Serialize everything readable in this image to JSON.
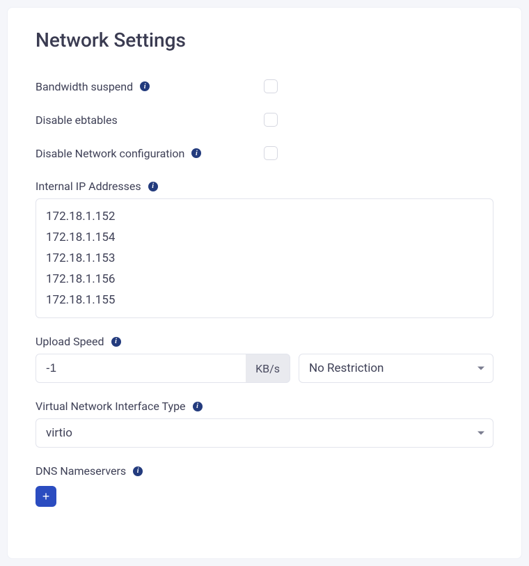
{
  "title": "Network Settings",
  "fields": {
    "bandwidth_suspend": {
      "label": "Bandwidth suspend"
    },
    "disable_ebtables": {
      "label": "Disable ebtables"
    },
    "disable_net_config": {
      "label": "Disable Network configuration"
    },
    "internal_ips": {
      "label": "Internal IP Addresses",
      "items": [
        "172.18.1.152",
        "172.18.1.154",
        "172.18.1.153",
        "172.18.1.156",
        "172.18.1.155"
      ]
    },
    "upload_speed": {
      "label": "Upload Speed",
      "value": "-1",
      "unit": "KB/s",
      "restriction": "No Restriction"
    },
    "vnic_type": {
      "label": "Virtual Network Interface Type",
      "value": "virtio"
    },
    "dns": {
      "label": "DNS Nameservers",
      "add_label": "+"
    }
  }
}
